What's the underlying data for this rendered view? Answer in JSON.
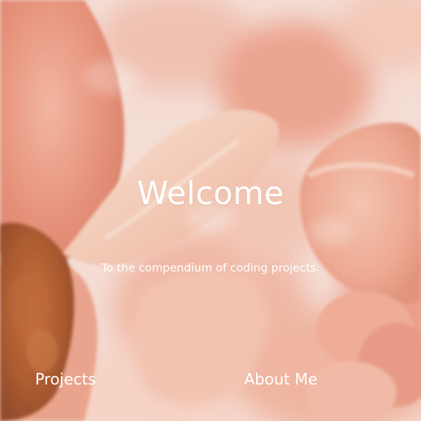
{
  "hero": {
    "title": "Welcome",
    "subtitle": "To the compendium of coding projects."
  },
  "nav": {
    "projects_label": "Projects",
    "about_label": "About Me"
  },
  "colors": {
    "text": "#ffffff",
    "petal_primary": "#e99c86",
    "petal_light": "#f6d7c8",
    "background_blush": "#f3d9d0"
  }
}
